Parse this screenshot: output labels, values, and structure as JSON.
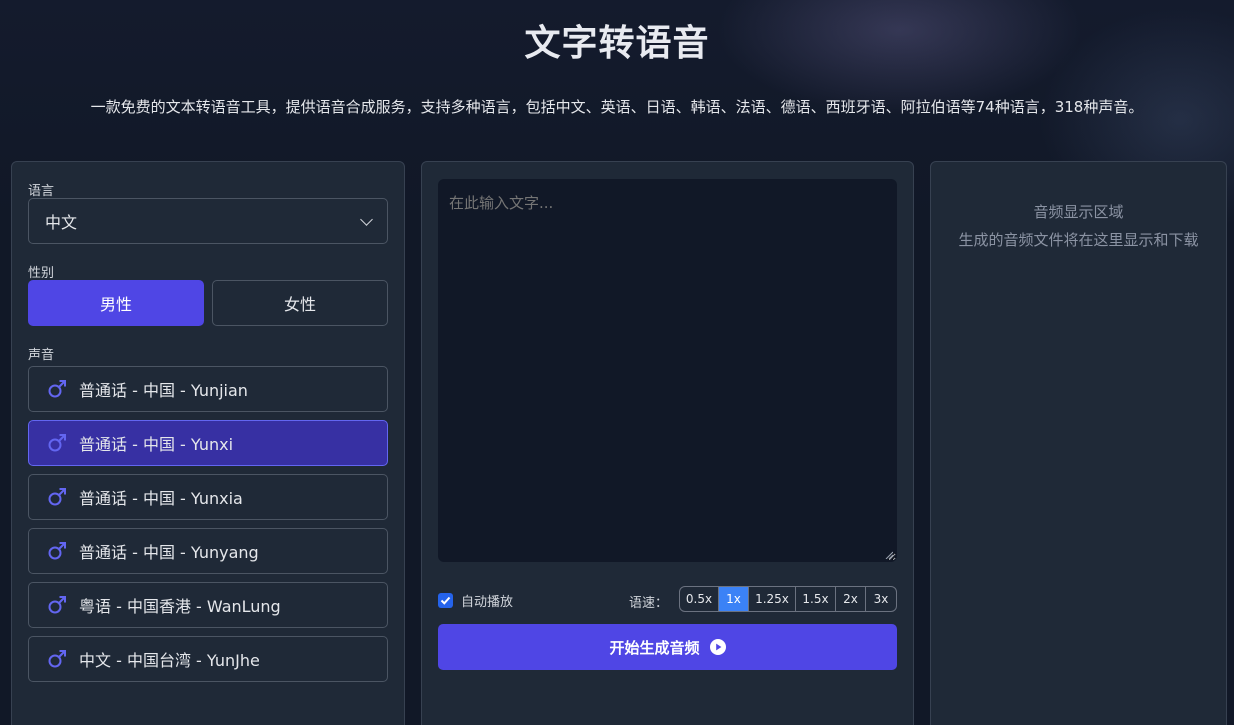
{
  "header": {
    "title": "文字转语音",
    "subtitle": "一款免费的文本转语音工具，提供语音合成服务，支持多种语言，包括中文、英语、日语、韩语、法语、德语、西班牙语、阿拉伯语等74种语言，318种声音。"
  },
  "left": {
    "language_label": "语言",
    "language_value": "中文",
    "gender_label": "性别",
    "gender_male": "男性",
    "gender_female": "女性",
    "gender_selected": "男性",
    "voice_label": "声音",
    "voices": [
      {
        "label": "普通话 - 中国 - Yunjian",
        "icon": "male-icon",
        "selected": false
      },
      {
        "label": "普通话 - 中国 - Yunxi",
        "icon": "male-icon",
        "selected": true
      },
      {
        "label": "普通话 - 中国 - Yunxia",
        "icon": "male-icon",
        "selected": false
      },
      {
        "label": "普通话 - 中国 - Yunyang",
        "icon": "male-icon",
        "selected": false
      },
      {
        "label": "粤语 - 中国香港 - WanLung",
        "icon": "male-icon",
        "selected": false
      },
      {
        "label": "中文 - 中国台湾 - YunJhe",
        "icon": "male-icon",
        "selected": false
      }
    ]
  },
  "middle": {
    "text_placeholder": "在此输入文字...",
    "text_value": "",
    "autoplay_label": "自动播放",
    "autoplay_checked": true,
    "speed_label": "语速：",
    "speed_options": [
      "0.5x",
      "1x",
      "1.25x",
      "1.5x",
      "2x",
      "3x"
    ],
    "speed_selected": "1x",
    "generate_label": "开始生成音频"
  },
  "right": {
    "audio_title": "音频显示区域",
    "audio_hint": "生成的音频文件将在这里显示和下载"
  },
  "colors": {
    "accent": "#4f46e5",
    "selected_voice": "#3730a3",
    "speed_active": "#3b82f6",
    "panel_bg": "#1f2937",
    "page_bg": "#111827",
    "male_icon": "#6366f1"
  }
}
